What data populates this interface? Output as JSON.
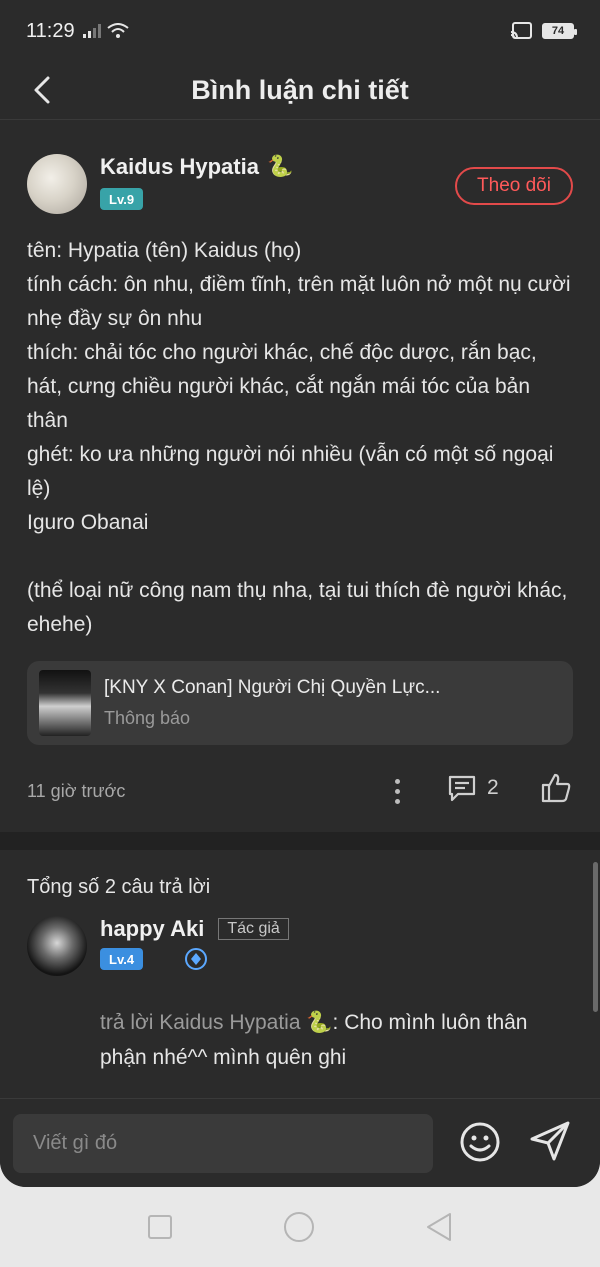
{
  "status_bar": {
    "time": "11:29",
    "battery": "74"
  },
  "header": {
    "title": "Bình luận chi tiết"
  },
  "post": {
    "author": "Kaidus Hypatia",
    "level": "Lv.9",
    "follow_label": "Theo dõi",
    "body": "tên: Hypatia (tên) Kaidus (họ)\ntính cách: ôn nhu, điềm tĩnh, trên mặt luôn nở một nụ cười nhẹ đầy sự ôn nhu\nthích: chải tóc cho người khác, chế độc dược, rắn bạc, hát, cưng chiều người khác, cắt ngắn mái tóc của bản thân\nghét: ko ưa những người nói nhiều (vẫn có một số ngoại lệ)\nIguro Obanai\n\n(thể loại nữ công nam thụ nha, tại tui thích đè người khác, ehehe)",
    "card": {
      "title": "[KNY X Conan] Người Chị Quyền Lực...",
      "subtitle": "Thông báo"
    },
    "time_ago": "11 giờ trước",
    "comment_count": "2"
  },
  "replies": {
    "total_label": "Tổng số 2 câu trả lời",
    "items": [
      {
        "author": "happy Aki",
        "tag": "Tác giả",
        "level": "Lv.4",
        "reply_to_prefix": "trả lời Kaidus Hypatia",
        "text": ": Cho mình luôn thân phận nhé^^ mình quên ghi"
      }
    ]
  },
  "composer": {
    "placeholder": "Viết gì đó"
  },
  "colors": {
    "follow": "#e24a4a",
    "level_post": "#38a3a8",
    "level_reply": "#3b8fe0",
    "background": "#2b2b2b"
  },
  "icons": [
    "back-icon",
    "comment-icon",
    "like-icon",
    "more-icon",
    "emoji-icon",
    "send-icon",
    "cast-icon",
    "wifi-icon"
  ]
}
